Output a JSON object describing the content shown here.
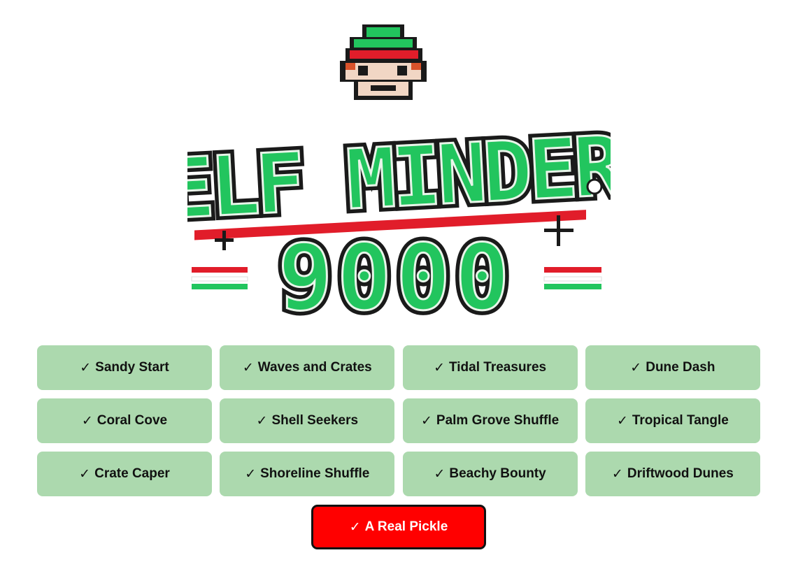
{
  "logo": {
    "line1": "ELF MINDER",
    "line2": "9000"
  },
  "check_glyph": "✓",
  "levels": [
    {
      "label": "Sandy Start",
      "completed": true
    },
    {
      "label": "Waves and Crates",
      "completed": true
    },
    {
      "label": "Tidal Treasures",
      "completed": true
    },
    {
      "label": "Dune Dash",
      "completed": true
    },
    {
      "label": "Coral Cove",
      "completed": true
    },
    {
      "label": "Shell Seekers",
      "completed": true
    },
    {
      "label": "Palm Grove Shuffle",
      "completed": true
    },
    {
      "label": "Tropical Tangle",
      "completed": true
    },
    {
      "label": "Crate Caper",
      "completed": true
    },
    {
      "label": "Shoreline Shuffle",
      "completed": true
    },
    {
      "label": "Beachy Bounty",
      "completed": true
    },
    {
      "label": "Driftwood Dunes",
      "completed": true
    }
  ],
  "final_level": {
    "label": "A Real Pickle",
    "completed": true
  },
  "colors": {
    "level_bg": "#acd9ae",
    "final_bg": "#ff0000",
    "logo_green": "#22c55e",
    "logo_red": "#e11d2a",
    "logo_outline": "#1a1a1a"
  }
}
